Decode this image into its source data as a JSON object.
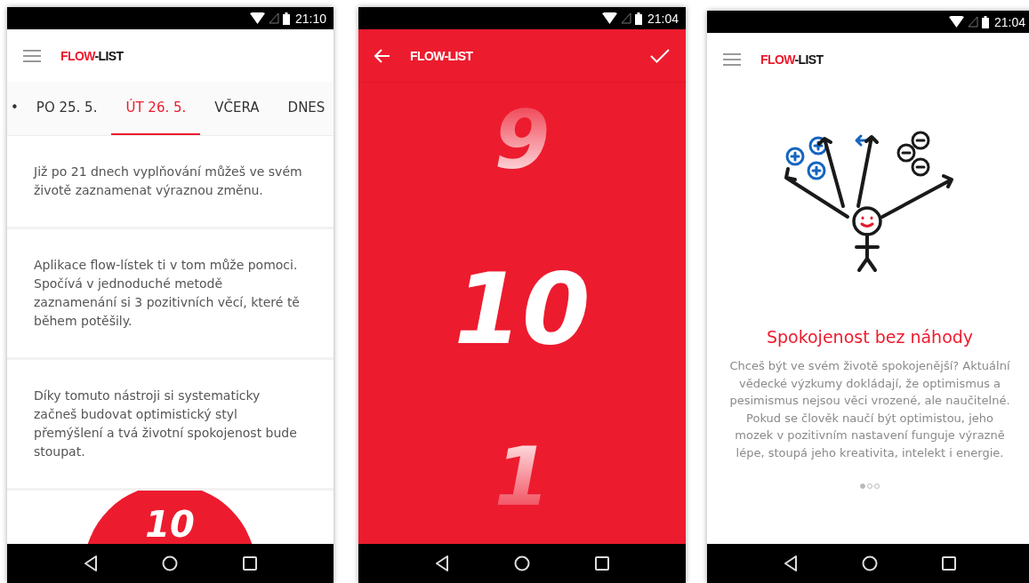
{
  "screens": [
    {
      "kind": "day-list",
      "status_bar": {
        "time": "21:10"
      },
      "app_bar": {
        "logo": {
          "accent": "FLOW",
          "rest": "-LIST"
        }
      },
      "tabs": [
        {
          "label": "•",
          "selected": false
        },
        {
          "label": "PO 25. 5.",
          "selected": false
        },
        {
          "label": "ÚT 26. 5.",
          "selected": true
        },
        {
          "label": "VČERA",
          "selected": false
        },
        {
          "label": "DNES",
          "selected": false
        }
      ],
      "cards": [
        "Již po 21 dnech vyplňování můžeš ve svém životě zaznamenat výraznou změnu.",
        "Aplikace flow-lístek ti v tom může pomoci. Spočívá v jednoduché metodě zaznamenání si 3 pozitivních věcí, které tě během potěšily.",
        "Díky tomuto nástroji si systematicky začneš budovat optimistický styl přemýšlení a tvá životní spokojenost bude stoupat."
      ],
      "score": "10"
    },
    {
      "kind": "number-picker",
      "status_bar": {
        "time": "21:04"
      },
      "app_bar": {
        "title": "FLOW-LIST"
      },
      "numbers": [
        {
          "text": "9",
          "selected": false
        },
        {
          "text": "10",
          "selected": true
        },
        {
          "text": "1",
          "selected": false
        }
      ]
    },
    {
      "kind": "intro",
      "status_bar": {
        "time": "21:04"
      },
      "app_bar": {
        "logo": {
          "accent": "FLOW",
          "rest": "-LIST"
        }
      },
      "title": "Spokojenost bez náhody",
      "body": "Chceš být ve svém životě spokojenější? Aktuální vědecké výzkumy dokládají, že optimismus a pesimismus nejsou věci vrozené, ale naučitelné. Pokud se člověk naučí být optimistou, jeho mozek v pozitivním nastavení funguje výrazně lépe, stoupá jeho kreativita, intelekt i energie.",
      "pager": [
        {
          "selected": true
        },
        {
          "selected": false
        },
        {
          "selected": false
        }
      ]
    }
  ]
}
